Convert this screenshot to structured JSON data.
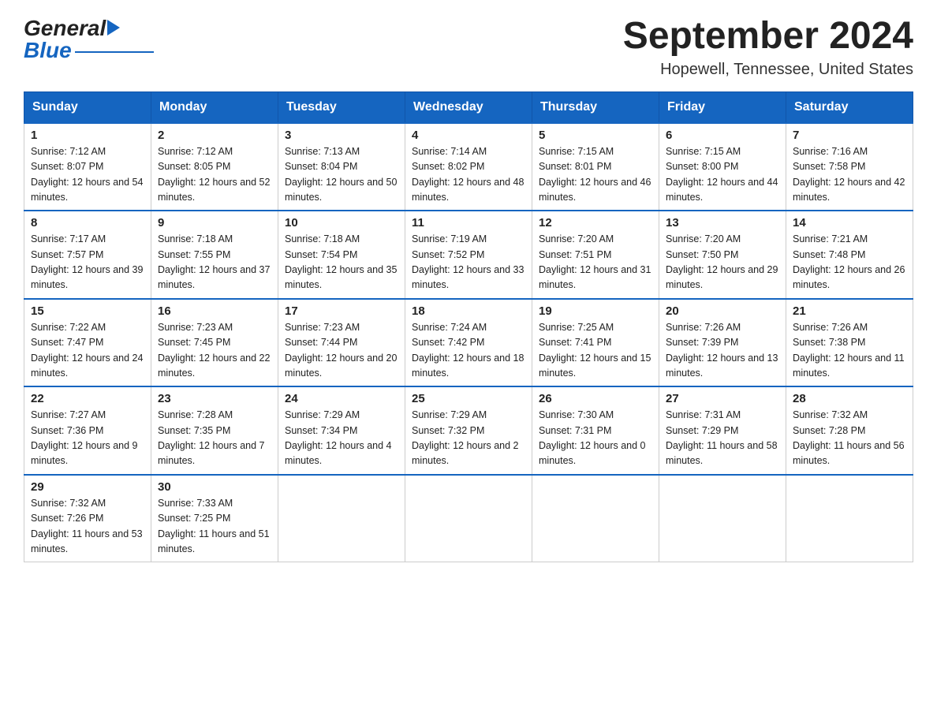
{
  "header": {
    "logo_text_black": "General",
    "logo_text_blue": "Blue",
    "month_title": "September 2024",
    "location": "Hopewell, Tennessee, United States"
  },
  "calendar": {
    "days_of_week": [
      "Sunday",
      "Monday",
      "Tuesday",
      "Wednesday",
      "Thursday",
      "Friday",
      "Saturday"
    ],
    "weeks": [
      [
        {
          "day": "1",
          "sunrise": "7:12 AM",
          "sunset": "8:07 PM",
          "daylight": "12 hours and 54 minutes."
        },
        {
          "day": "2",
          "sunrise": "7:12 AM",
          "sunset": "8:05 PM",
          "daylight": "12 hours and 52 minutes."
        },
        {
          "day": "3",
          "sunrise": "7:13 AM",
          "sunset": "8:04 PM",
          "daylight": "12 hours and 50 minutes."
        },
        {
          "day": "4",
          "sunrise": "7:14 AM",
          "sunset": "8:02 PM",
          "daylight": "12 hours and 48 minutes."
        },
        {
          "day": "5",
          "sunrise": "7:15 AM",
          "sunset": "8:01 PM",
          "daylight": "12 hours and 46 minutes."
        },
        {
          "day": "6",
          "sunrise": "7:15 AM",
          "sunset": "8:00 PM",
          "daylight": "12 hours and 44 minutes."
        },
        {
          "day": "7",
          "sunrise": "7:16 AM",
          "sunset": "7:58 PM",
          "daylight": "12 hours and 42 minutes."
        }
      ],
      [
        {
          "day": "8",
          "sunrise": "7:17 AM",
          "sunset": "7:57 PM",
          "daylight": "12 hours and 39 minutes."
        },
        {
          "day": "9",
          "sunrise": "7:18 AM",
          "sunset": "7:55 PM",
          "daylight": "12 hours and 37 minutes."
        },
        {
          "day": "10",
          "sunrise": "7:18 AM",
          "sunset": "7:54 PM",
          "daylight": "12 hours and 35 minutes."
        },
        {
          "day": "11",
          "sunrise": "7:19 AM",
          "sunset": "7:52 PM",
          "daylight": "12 hours and 33 minutes."
        },
        {
          "day": "12",
          "sunrise": "7:20 AM",
          "sunset": "7:51 PM",
          "daylight": "12 hours and 31 minutes."
        },
        {
          "day": "13",
          "sunrise": "7:20 AM",
          "sunset": "7:50 PM",
          "daylight": "12 hours and 29 minutes."
        },
        {
          "day": "14",
          "sunrise": "7:21 AM",
          "sunset": "7:48 PM",
          "daylight": "12 hours and 26 minutes."
        }
      ],
      [
        {
          "day": "15",
          "sunrise": "7:22 AM",
          "sunset": "7:47 PM",
          "daylight": "12 hours and 24 minutes."
        },
        {
          "day": "16",
          "sunrise": "7:23 AM",
          "sunset": "7:45 PM",
          "daylight": "12 hours and 22 minutes."
        },
        {
          "day": "17",
          "sunrise": "7:23 AM",
          "sunset": "7:44 PM",
          "daylight": "12 hours and 20 minutes."
        },
        {
          "day": "18",
          "sunrise": "7:24 AM",
          "sunset": "7:42 PM",
          "daylight": "12 hours and 18 minutes."
        },
        {
          "day": "19",
          "sunrise": "7:25 AM",
          "sunset": "7:41 PM",
          "daylight": "12 hours and 15 minutes."
        },
        {
          "day": "20",
          "sunrise": "7:26 AM",
          "sunset": "7:39 PM",
          "daylight": "12 hours and 13 minutes."
        },
        {
          "day": "21",
          "sunrise": "7:26 AM",
          "sunset": "7:38 PM",
          "daylight": "12 hours and 11 minutes."
        }
      ],
      [
        {
          "day": "22",
          "sunrise": "7:27 AM",
          "sunset": "7:36 PM",
          "daylight": "12 hours and 9 minutes."
        },
        {
          "day": "23",
          "sunrise": "7:28 AM",
          "sunset": "7:35 PM",
          "daylight": "12 hours and 7 minutes."
        },
        {
          "day": "24",
          "sunrise": "7:29 AM",
          "sunset": "7:34 PM",
          "daylight": "12 hours and 4 minutes."
        },
        {
          "day": "25",
          "sunrise": "7:29 AM",
          "sunset": "7:32 PM",
          "daylight": "12 hours and 2 minutes."
        },
        {
          "day": "26",
          "sunrise": "7:30 AM",
          "sunset": "7:31 PM",
          "daylight": "12 hours and 0 minutes."
        },
        {
          "day": "27",
          "sunrise": "7:31 AM",
          "sunset": "7:29 PM",
          "daylight": "11 hours and 58 minutes."
        },
        {
          "day": "28",
          "sunrise": "7:32 AM",
          "sunset": "7:28 PM",
          "daylight": "11 hours and 56 minutes."
        }
      ],
      [
        {
          "day": "29",
          "sunrise": "7:32 AM",
          "sunset": "7:26 PM",
          "daylight": "11 hours and 53 minutes."
        },
        {
          "day": "30",
          "sunrise": "7:33 AM",
          "sunset": "7:25 PM",
          "daylight": "11 hours and 51 minutes."
        },
        null,
        null,
        null,
        null,
        null
      ]
    ]
  }
}
